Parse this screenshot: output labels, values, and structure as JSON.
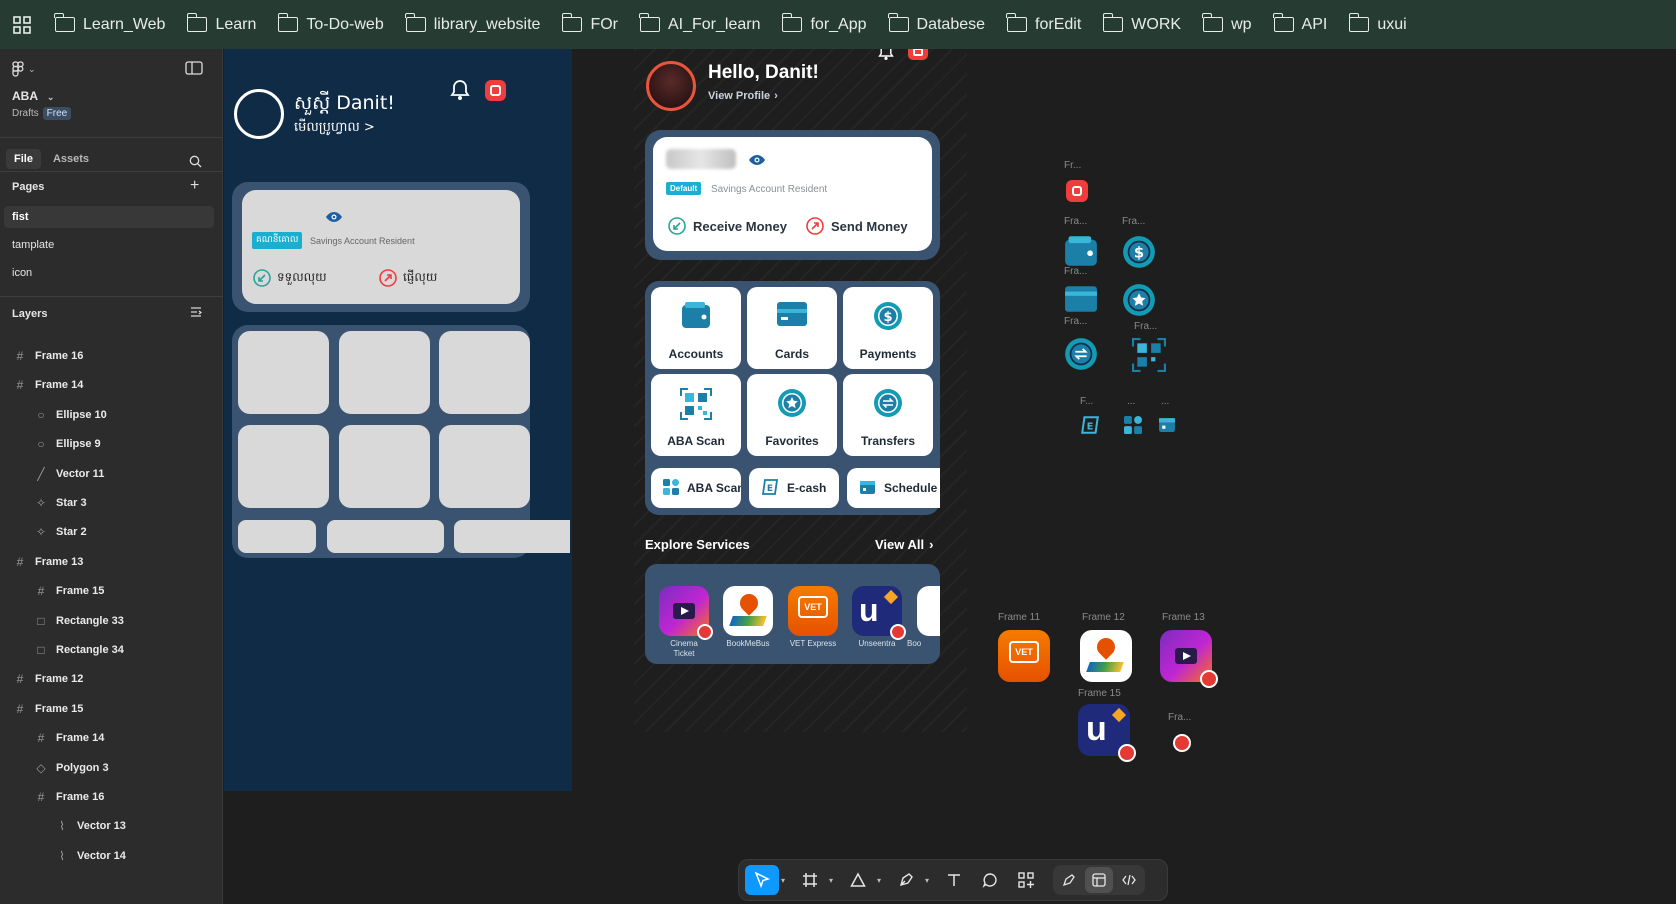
{
  "bookmarks": [
    "Learn_Web",
    "Learn",
    "To-Do-web",
    "library_website",
    "FOr",
    "AI_For_learn",
    "for_App",
    "Databese",
    "forEdit",
    "WORK",
    "wp",
    "API",
    "uxui"
  ],
  "sidebar": {
    "project": "ABA",
    "drafts": "Drafts",
    "plan": "Free",
    "tab_file": "File",
    "tab_assets": "Assets",
    "pages_title": "Pages",
    "pages": [
      "fist",
      "tamplate",
      "icon"
    ],
    "layers_title": "Layers",
    "layers": [
      {
        "name": "Frame 16",
        "icon": "frame"
      },
      {
        "name": "Frame 14",
        "icon": "frame"
      },
      {
        "name": "Ellipse 10",
        "icon": "ellipse"
      },
      {
        "name": "Ellipse 9",
        "icon": "ellipse"
      },
      {
        "name": "Vector 11",
        "icon": "line"
      },
      {
        "name": "Star 3",
        "icon": "star"
      },
      {
        "name": "Star 2",
        "icon": "star"
      },
      {
        "name": "Frame 13",
        "icon": "frame"
      },
      {
        "name": "Frame 15",
        "icon": "frame"
      },
      {
        "name": "Rectangle 33",
        "icon": "rect"
      },
      {
        "name": "Rectangle 34",
        "icon": "rect"
      },
      {
        "name": "Frame 12",
        "icon": "frame"
      },
      {
        "name": "Frame 15",
        "icon": "frame"
      },
      {
        "name": "Frame 14",
        "icon": "frame"
      },
      {
        "name": "Polygon 3",
        "icon": "polygon"
      },
      {
        "name": "Frame 16",
        "icon": "frame"
      },
      {
        "name": "Vector 13",
        "icon": "vector"
      },
      {
        "name": "Vector 14",
        "icon": "vector"
      }
    ]
  },
  "wireframe": {
    "greeting": "សួស្តី Danit!",
    "view_profile": "មើលប្រូហ្វាល >",
    "default_badge": "គណនីគោល",
    "account_type": "Savings Account Resident",
    "receive": "ទទួលលុយ",
    "send": "ផ្ញើលុយ"
  },
  "app": {
    "greeting": "Hello, Danit!",
    "view_profile": "View Profile",
    "default_badge": "Default",
    "account_type": "Savings Account Resident",
    "receive": "Receive Money",
    "send": "Send Money",
    "tiles": [
      "Accounts",
      "Cards",
      "Payments",
      "ABA Scan",
      "Favorites",
      "Transfers"
    ],
    "quick": [
      "ABA Scan",
      "E-cash",
      "Schedule"
    ],
    "explore_title": "Explore Services",
    "view_all": "View All",
    "services": [
      {
        "name": "Cinema\nTicket"
      },
      {
        "name": "BookMeBus"
      },
      {
        "name": "VET Express"
      },
      {
        "name": "Unseentra"
      },
      {
        "name": "Boo"
      }
    ]
  },
  "assets": {
    "short_labels": [
      "Fr...",
      "Fra...",
      "Fra...",
      "Fra...",
      "Fra...",
      "Fra...",
      "Fra...",
      "F...",
      "...",
      "..."
    ],
    "frames": [
      "Frame 11",
      "Frame 12",
      "Frame 13",
      "Frame 15",
      "Fra..."
    ]
  },
  "colors": {
    "accent": "#0d99ff",
    "app_bg": "#0f2b46",
    "teal": "#139bb3",
    "red": "#ef3d3d"
  }
}
